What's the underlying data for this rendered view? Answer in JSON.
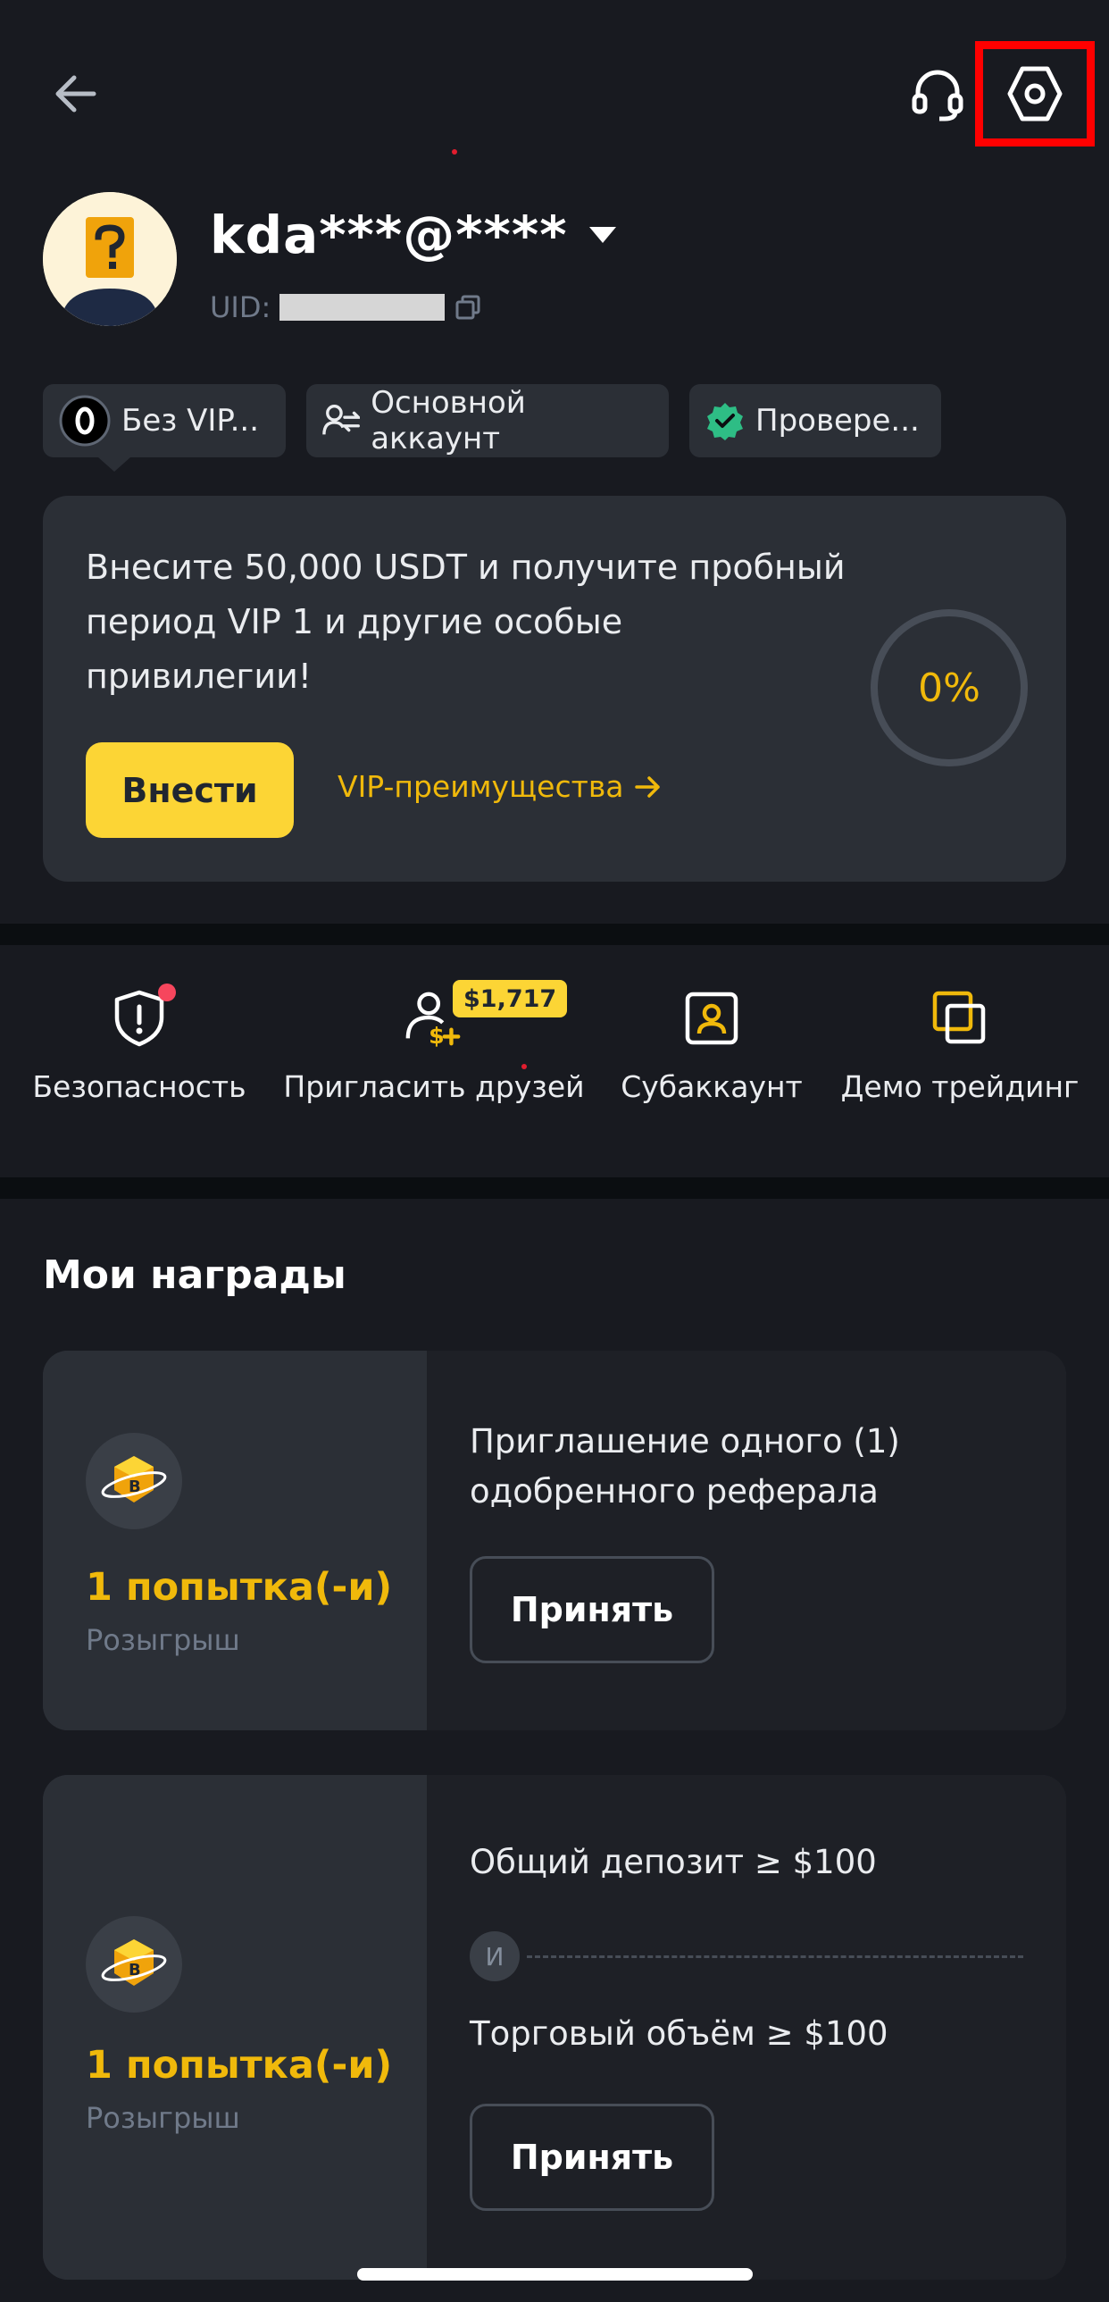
{
  "header": {
    "back_icon": "arrow-left-icon",
    "support_icon": "headset-icon",
    "settings_icon": "settings-hexagon-icon"
  },
  "profile": {
    "username": "kda***@****",
    "uid_label": "UID:",
    "avatar_icon": "question-avatar-icon"
  },
  "badges": [
    {
      "label": "Без VIP...",
      "icon": "vip-zero-icon"
    },
    {
      "label": "Основной аккаунт",
      "icon": "account-switch-icon"
    },
    {
      "label": "Провере...",
      "icon": "verified-check-icon"
    }
  ],
  "vip_card": {
    "text": "Внесите 50,000 USDT и получите пробный период VIP 1 и другие особые привилегии!",
    "deposit_label": "Внести",
    "link_label": "VIP-преимущества",
    "progress_text": "0%",
    "progress_value": 0
  },
  "shortcuts": [
    {
      "label": "Безопасность",
      "icon": "shield-alert-icon"
    },
    {
      "label": "Пригласить друзей",
      "icon": "invite-friends-icon"
    },
    {
      "label": "Субаккаунт",
      "icon": "subaccount-icon"
    },
    {
      "label": "Демо трейдинг",
      "icon": "demo-trading-icon"
    }
  ],
  "invite_promo": "$1,717",
  "rewards": {
    "title": "Мои награды",
    "cards": [
      {
        "count": "1 попытка(-и)",
        "kind": "Розыгрыш",
        "task": "Приглашение одного (1) одобренного реферала",
        "accept_label": "Принять"
      },
      {
        "count": "1 попытка(-и)",
        "kind": "Розыгрыш",
        "task_1": "Общий депозит ≥ $100",
        "and_label": "И",
        "task_2": "Торговый объём ≥ $100",
        "accept_label": "Принять"
      }
    ]
  },
  "colors": {
    "accent": "#fcd535",
    "accent_text": "#f0b90b",
    "background": "#181a20",
    "card": "#2b2f36",
    "highlight_box": "#ff0000"
  }
}
